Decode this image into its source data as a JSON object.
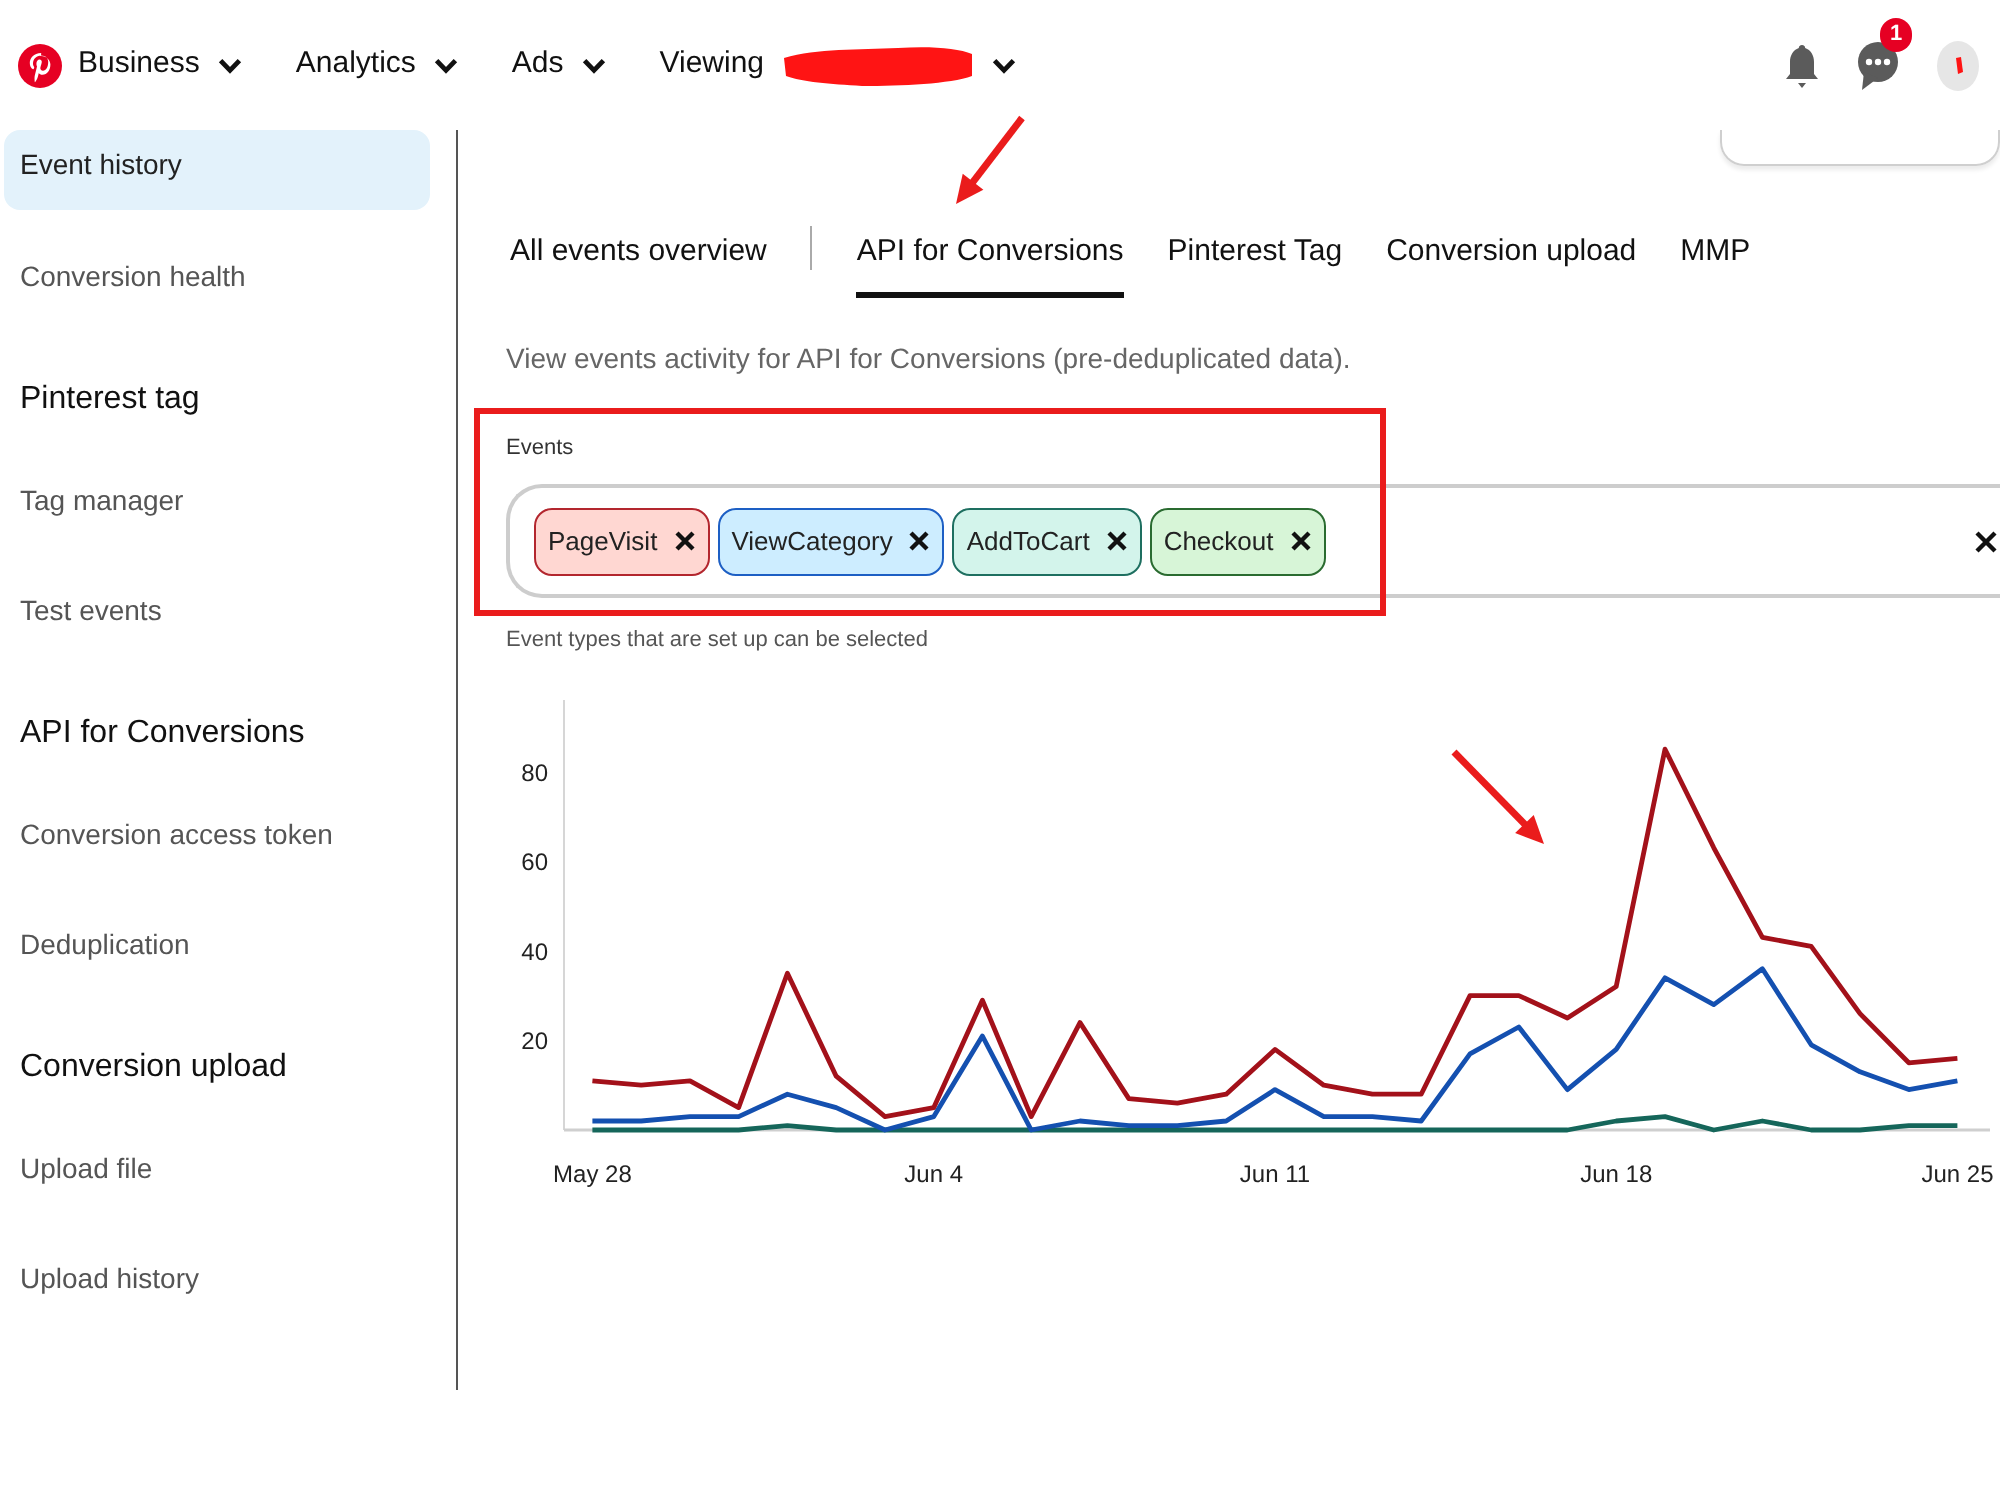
{
  "nav": {
    "items": [
      {
        "label": "Business",
        "redacted": false
      },
      {
        "label": "Analytics",
        "redacted": false
      },
      {
        "label": "Ads",
        "redacted": false
      },
      {
        "label": "Viewing",
        "redacted": true
      }
    ],
    "messages_badge": "1"
  },
  "sidebar": {
    "sections": [
      {
        "items": [
          {
            "label": "Event history",
            "selected": true
          },
          {
            "label": "Conversion health",
            "selected": false
          }
        ]
      },
      {
        "title": "Pinterest tag",
        "items": [
          {
            "label": "Tag manager",
            "selected": false
          },
          {
            "label": "Test events",
            "selected": false
          }
        ]
      },
      {
        "title": "API for Conversions",
        "items": [
          {
            "label": "Conversion access token",
            "selected": false
          },
          {
            "label": "Deduplication",
            "selected": false
          }
        ]
      },
      {
        "title": "Conversion upload",
        "items": [
          {
            "label": "Upload file",
            "selected": false
          },
          {
            "label": "Upload history",
            "selected": false
          }
        ]
      }
    ]
  },
  "tabs": [
    {
      "label": "All events overview",
      "selected": false
    },
    {
      "label": "API for Conversions",
      "selected": true
    },
    {
      "label": "Pinterest Tag",
      "selected": false
    },
    {
      "label": "Conversion upload",
      "selected": false
    },
    {
      "label": "MMP",
      "selected": false
    }
  ],
  "description": "View events activity for API for Conversions (pre-deduplicated data).",
  "events_filter": {
    "label": "Events",
    "chips": [
      {
        "label": "PageVisit",
        "color": "#b3262e"
      },
      {
        "label": "ViewCategory",
        "color": "#1d5fc4"
      },
      {
        "label": "AddToCart",
        "color": "#1e6f60"
      },
      {
        "label": "Checkout",
        "color": "#2a6b30"
      }
    ],
    "helper_text": "Event types that are set up can be selected"
  },
  "events_chart": {
    "chart_data": [
      {
        "type": "line",
        "x": [
          "--05-28",
          "--05-29",
          "--05-30",
          "--05-31",
          "--06-01",
          "--06-02",
          "--06-03",
          "--06-04",
          "--06-05",
          "--06-06",
          "--06-07",
          "--06-08",
          "--06-09",
          "--06-10",
          "--06-11",
          "--06-12",
          "--06-13",
          "--06-14",
          "--06-15",
          "--06-16",
          "--06-17",
          "--06-18",
          "--06-19",
          "--06-20",
          "--06-21",
          "--06-22",
          "--06-23",
          "--06-24",
          "--06-25"
        ],
        "xlim": [
          "--05-27T10:00",
          "--06-25T16:00"
        ],
        "xticks": [
          {
            "value": "--05-28",
            "label": "May 28"
          },
          {
            "value": "--06-04",
            "label": "Jun 4"
          },
          {
            "value": "--06-11",
            "label": "Jun 11"
          },
          {
            "value": "--06-18",
            "label": "Jun 18"
          },
          {
            "value": "--06-25",
            "label": "Jun 25"
          }
        ],
        "ylim": [
          0,
          96
        ],
        "yticks": [
          20,
          40,
          60,
          80
        ],
        "series": [
          {
            "color": "#15665a",
            "values": [
              0,
              0,
              0,
              0,
              1,
              0,
              0,
              0,
              0,
              0,
              0,
              0,
              0,
              0,
              0,
              0,
              0,
              0,
              0,
              0,
              0,
              2,
              3,
              0,
              2,
              0,
              0,
              1,
              1
            ]
          },
          {
            "color": "#1450b0",
            "values": [
              2,
              2,
              3,
              3,
              8,
              5,
              0,
              3,
              21,
              0,
              2,
              1,
              1,
              2,
              9,
              3,
              3,
              2,
              17,
              23,
              9,
              18,
              34,
              28,
              36,
              19,
              13,
              9,
              11
            ]
          },
          {
            "color": "#a3111a",
            "values": [
              11,
              10,
              11,
              5,
              35,
              12,
              3,
              5,
              29,
              3,
              24,
              7,
              6,
              8,
              18,
              10,
              8,
              8,
              30,
              30,
              25,
              32,
              85,
              63,
              43,
              41,
              26,
              15,
              16
            ]
          }
        ]
      }
    ]
  }
}
